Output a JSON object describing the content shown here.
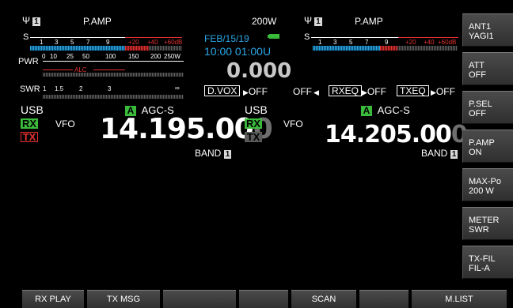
{
  "main": {
    "antenna_num": "1",
    "preamp": "P.AMP",
    "power": "200W",
    "s_label": "S",
    "s_scale": [
      "1",
      "3",
      "5",
      "7",
      "9"
    ],
    "s_scale_red": [
      "+20",
      "+40",
      "+60dB"
    ],
    "pwr_label": "PWR",
    "pwr_scale": [
      "0",
      "10",
      "25",
      "50",
      "100",
      "150",
      "200",
      "250W"
    ],
    "alc_label": "ALC",
    "swr_label": "SWR",
    "swr_scale": [
      "1",
      "1.5",
      "2",
      "3",
      "∞"
    ],
    "mode": "USB",
    "a_badge": "A",
    "agc": "AGC-S",
    "rx": "RX",
    "tx": "TX",
    "vfo": "VFO",
    "freq_main": "14.195.00",
    "freq_last": "0",
    "band_label": "BAND",
    "band_num": "1"
  },
  "center": {
    "date": "FEB/15/19",
    "time": "10:00 01:00U",
    "big_value": "0.000",
    "dvox_label": "D.VOX",
    "dvox_value": "OFF"
  },
  "sub": {
    "antenna_num": "1",
    "preamp": "P.AMP",
    "s_label": "S",
    "s_scale": [
      "1",
      "3",
      "5",
      "7",
      "9"
    ],
    "s_scale_red": [
      "+20",
      "+40",
      "+60dB"
    ],
    "mode": "USB",
    "a_badge": "A",
    "agc": "AGC-S",
    "rx": "RX",
    "tx": "TX",
    "vfo": "VFO",
    "freq_main": "14.205.00",
    "freq_last": "0",
    "band_label": "BAND",
    "band_num": "1",
    "eq_left_off": "OFF",
    "rxeq_label": "RXEQ",
    "rxeq_value": "OFF",
    "txeq_label": "TXEQ",
    "txeq_value": "OFF"
  },
  "sidebar": [
    {
      "line1": "ANT1",
      "line2": "YAGI1"
    },
    {
      "line1": "ATT",
      "line2": "OFF"
    },
    {
      "line1": "P.SEL",
      "line2": "OFF"
    },
    {
      "line1": "P.AMP",
      "line2": "ON"
    },
    {
      "line1": "MAX-Po",
      "line2": "200 W"
    },
    {
      "line1": "METER",
      "line2": "SWR"
    },
    {
      "line1": "TX-FIL",
      "line2": "FIL-A"
    }
  ],
  "function_keys": [
    "RX PLAY",
    "TX MSG",
    "",
    "",
    "SCAN",
    "",
    "M.LIST"
  ],
  "colors": {
    "accent_cyan": "#29a8e8",
    "rx_green": "#3bbb3b",
    "tx_red": "#e33232",
    "meter_blue": "#2aa7e6"
  }
}
